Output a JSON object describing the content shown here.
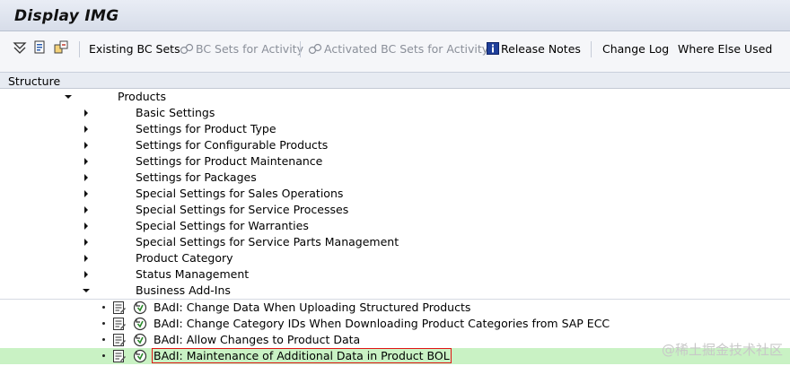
{
  "window": {
    "title": "Display IMG"
  },
  "toolbar": {
    "existing_bc_sets": "Existing BC Sets",
    "bc_sets_for_activity": "BC Sets for Activity",
    "activated_bc_sets": "Activated BC Sets for Activity",
    "release_notes": "Release Notes",
    "change_log": "Change Log",
    "where_else_used": "Where Else Used"
  },
  "structure_header": "Structure",
  "tree": {
    "root": "Products",
    "children": [
      "Basic Settings",
      "Settings for Product Type",
      "Settings for Configurable Products",
      "Settings for Product Maintenance",
      "Settings for Packages",
      "Special Settings for Sales Operations",
      "Special Settings for Service Processes",
      "Special Settings for Warranties",
      "Special Settings for Service Parts Management",
      "Product Category",
      "Status Management"
    ],
    "expanded_node": "Business Add-Ins",
    "badis": [
      "BAdI: Change Data When Uploading Structured Products",
      "BAdI: Change Category IDs When Downloading Product Categories from SAP ECC",
      "BAdI: Allow Changes to Product Data",
      "BAdI: Maintenance of Additional Data in Product BOL"
    ]
  },
  "watermark": "@稀土掘金技术社区"
}
